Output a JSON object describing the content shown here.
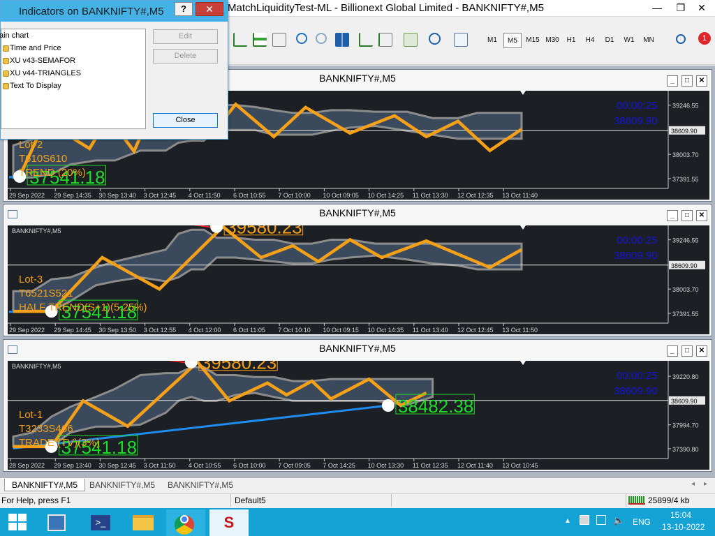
{
  "app": {
    "title": "MatchLiquidityTest-ML - Billionext Global Limited - BANKNIFTY#,M5"
  },
  "window_controls": {
    "minimize": "—",
    "restore": "❐",
    "close": "✕"
  },
  "toolbar": {
    "timeframes": [
      "M1",
      "M5",
      "M15",
      "M30",
      "H1",
      "H4",
      "D1",
      "W1",
      "MN"
    ],
    "active_timeframe": "M5",
    "notification_count": "1"
  },
  "dialog": {
    "title": "Indicators on BANKNIFTY#,M5",
    "help": "?",
    "close_x": "✕",
    "tree": [
      "ain chart",
      "Time and Price",
      "XU v43-SEMAFOR",
      "XU v44-TRIANGLES",
      "Text To Display"
    ],
    "buttons": {
      "edit": "Edit",
      "delete": "Delete",
      "close": "Close"
    }
  },
  "charts": [
    {
      "title": "BANKNIFTY#,M5",
      "symbol_label": "",
      "timer": "00:00:25",
      "current_price": "38609.90",
      "price_tag": "38609.90",
      "yticks": [
        {
          "v": 39246.55,
          "label": "39246.55"
        },
        {
          "v": 38003.7,
          "label": "38003.70"
        },
        {
          "v": 37391.55,
          "label": "37391.55"
        }
      ],
      "ymin": 37320,
      "ymax": 39540,
      "dates": [
        "29 Sep 2022",
        "29 Sep 14:35",
        "30 Sep 13:40",
        "3 Oct 12:45",
        "4 Oct 11:50",
        "6 Oct 10:55",
        "7 Oct 10:00",
        "10 Oct 09:05",
        "10 Oct 14:25",
        "11 Oct 13:30",
        "12 Oct 12:35",
        "13 Oct 11:40"
      ],
      "lot_lines": [
        "Lot-2",
        "T610S610",
        "TREND (20%)"
      ],
      "markers": [
        {
          "i": 1,
          "v": 37445,
          "label": "37541.18",
          "color": "#1fdc2a"
        }
      ],
      "zigzag": [
        [
          1,
          37445
        ],
        [
          5,
          38850
        ],
        [
          12,
          38150
        ],
        [
          15,
          38950
        ],
        [
          19,
          38080
        ],
        [
          23,
          39560
        ],
        [
          30,
          38850
        ],
        [
          32,
          38650
        ],
        [
          35,
          39270
        ],
        [
          41,
          38450
        ],
        [
          46,
          39190
        ],
        [
          53,
          38540
        ],
        [
          60,
          38980
        ],
        [
          65,
          38450
        ],
        [
          70,
          38840
        ],
        [
          75,
          38100
        ],
        [
          80,
          38640
        ]
      ],
      "envelope": {
        "top": [
          [
            0,
            38230
          ],
          [
            3,
            38380
          ],
          [
            6,
            38480
          ],
          [
            9,
            38680
          ],
          [
            13,
            38700
          ],
          [
            16,
            38880
          ],
          [
            20,
            38880
          ],
          [
            24,
            39000
          ],
          [
            26,
            39250
          ],
          [
            28,
            39450
          ],
          [
            30,
            39450
          ],
          [
            32,
            39250
          ],
          [
            35,
            39250
          ],
          [
            38,
            39200
          ],
          [
            41,
            39120
          ],
          [
            44,
            39050
          ],
          [
            47,
            39050
          ],
          [
            50,
            39120
          ],
          [
            53,
            39120
          ],
          [
            57,
            39080
          ],
          [
            62,
            39080
          ],
          [
            66,
            38920
          ],
          [
            70,
            38920
          ],
          [
            73,
            39050
          ],
          [
            80,
            39050
          ]
        ],
        "bottom": [
          [
            0,
            37420
          ],
          [
            3,
            37420
          ],
          [
            6,
            37500
          ],
          [
            9,
            37750
          ],
          [
            13,
            37850
          ],
          [
            16,
            37850
          ],
          [
            20,
            38100
          ],
          [
            24,
            38100
          ],
          [
            26,
            38300
          ],
          [
            28,
            38350
          ],
          [
            30,
            38350
          ],
          [
            32,
            38620
          ],
          [
            35,
            38620
          ],
          [
            38,
            38620
          ],
          [
            41,
            38500
          ],
          [
            44,
            38500
          ],
          [
            47,
            38500
          ],
          [
            50,
            38600
          ],
          [
            53,
            38680
          ],
          [
            57,
            38720
          ],
          [
            62,
            38600
          ],
          [
            66,
            38500
          ],
          [
            70,
            38400
          ],
          [
            73,
            38400
          ],
          [
            80,
            38400
          ]
        ]
      }
    },
    {
      "title": "BANKNIFTY#,M5",
      "symbol_label": "BANKNIFTY#,M5",
      "timer": "00:00:25",
      "current_price": "38609.90",
      "price_tag": "38609.90",
      "yticks": [
        {
          "v": 39246.55,
          "label": "39246.55"
        },
        {
          "v": 38003.7,
          "label": "38003.70"
        },
        {
          "v": 37391.55,
          "label": "37391.55"
        }
      ],
      "ymin": 37320,
      "ymax": 39540,
      "dates": [
        "29 Sep 2022",
        "29 Sep 14:45",
        "30 Sep 13:50",
        "3 Oct 12:55",
        "4 Oct 12:00",
        "6 Oct 11:05",
        "7 Oct 10:10",
        "10 Oct 09:15",
        "10 Oct 14:35",
        "11 Oct 13:40",
        "12 Oct 12:45",
        "13 Oct 11:50"
      ],
      "lot_lines": [
        "Lot-3",
        "T6521S521",
        "HALF TREND(S+1)(5.25%)"
      ],
      "markers": [
        {
          "i": 6,
          "v": 37441,
          "label": "37541.18",
          "color": "#1fdc2a"
        },
        {
          "i": 32,
          "v": 39580,
          "label": "39580.23",
          "color": "#f5a019"
        }
      ],
      "zigzag": [
        [
          0,
          37441
        ],
        [
          6,
          37441
        ],
        [
          14,
          38800
        ],
        [
          23,
          38003
        ],
        [
          33,
          39580
        ],
        [
          39,
          38800
        ],
        [
          44,
          39100
        ],
        [
          48,
          38700
        ],
        [
          53,
          39250
        ],
        [
          58,
          38800
        ],
        [
          65,
          39220
        ],
        [
          75,
          38550
        ],
        [
          80,
          39000
        ]
      ],
      "envelope": {
        "top": [
          [
            0,
            37950
          ],
          [
            3,
            37950
          ],
          [
            6,
            38250
          ],
          [
            9,
            38300
          ],
          [
            13,
            38550
          ],
          [
            16,
            38700
          ],
          [
            20,
            38850
          ],
          [
            24,
            39000
          ],
          [
            26,
            39400
          ],
          [
            28,
            39500
          ],
          [
            30,
            39500
          ],
          [
            32,
            39300
          ],
          [
            35,
            39300
          ],
          [
            38,
            39250
          ],
          [
            41,
            39250
          ],
          [
            44,
            39150
          ],
          [
            47,
            39150
          ],
          [
            50,
            39250
          ],
          [
            53,
            39250
          ],
          [
            57,
            39150
          ],
          [
            62,
            39150
          ],
          [
            66,
            39150
          ],
          [
            70,
            39150
          ],
          [
            73,
            39150
          ],
          [
            80,
            39150
          ]
        ],
        "bottom": [
          [
            0,
            37441
          ],
          [
            3,
            37441
          ],
          [
            6,
            37441
          ],
          [
            9,
            37700
          ],
          [
            13,
            38100
          ],
          [
            16,
            38200
          ],
          [
            20,
            38300
          ],
          [
            24,
            38200
          ],
          [
            26,
            38300
          ],
          [
            28,
            38500
          ],
          [
            30,
            38500
          ],
          [
            32,
            38800
          ],
          [
            35,
            38800
          ],
          [
            38,
            38750
          ],
          [
            41,
            38700
          ],
          [
            44,
            38650
          ],
          [
            47,
            38650
          ],
          [
            50,
            38750
          ],
          [
            53,
            38800
          ],
          [
            57,
            38850
          ],
          [
            62,
            38750
          ],
          [
            66,
            38650
          ],
          [
            70,
            38600
          ],
          [
            73,
            38500
          ],
          [
            80,
            38500
          ]
        ]
      }
    },
    {
      "title": "BANKNIFTY#,M5",
      "symbol_label": "BANKNIFTY#,M5",
      "timer": "00:00:25",
      "current_price": "38609.90",
      "price_tag": "38609.90",
      "yticks": [
        {
          "v": 39220.8,
          "label": "39220.80"
        },
        {
          "v": 37994.7,
          "label": "37994.70"
        },
        {
          "v": 37390.8,
          "label": "37390.80"
        }
      ],
      "ymin": 37320,
      "ymax": 39540,
      "dates": [
        "28 Sep 2022",
        "29 Sep 13:40",
        "30 Sep 12:45",
        "3 Oct 11:50",
        "4 Oct 10:55",
        "6 Oct 10:00",
        "7 Oct 09:05",
        "7 Oct 14:25",
        "10 Oct 13:30",
        "11 Oct 12:35",
        "12 Oct 11:40",
        "13 Oct 10:45"
      ],
      "lot_lines": [
        "Lot-1",
        "T3233S466",
        "TRADE (TV)(3%)"
      ],
      "markers": [
        {
          "i": 6,
          "v": 37445,
          "label": "37541.18",
          "color": "#1fdc2a"
        },
        {
          "i": 28,
          "v": 39580,
          "label": "39580.23",
          "color": "#f5a019"
        },
        {
          "i": 59,
          "v": 38482,
          "label": "38482.38",
          "color": "#1fdc2a"
        }
      ],
      "trendline": [
        [
          0,
          37400
        ],
        [
          59,
          38482
        ]
      ],
      "zigzag": [
        [
          0,
          37445
        ],
        [
          6,
          37445
        ],
        [
          11,
          38600
        ],
        [
          18,
          37960
        ],
        [
          29,
          39580
        ],
        [
          34,
          38600
        ],
        [
          40,
          39050
        ],
        [
          43,
          38750
        ],
        [
          47,
          39100
        ],
        [
          50,
          38650
        ],
        [
          56,
          39150
        ],
        [
          61,
          38482
        ],
        [
          65,
          38800
        ]
      ],
      "envelope": {
        "top": [
          [
            0,
            37700
          ],
          [
            3,
            37800
          ],
          [
            6,
            38200
          ],
          [
            9,
            38450
          ],
          [
            13,
            38700
          ],
          [
            16,
            38900
          ],
          [
            20,
            39250
          ],
          [
            24,
            39300
          ],
          [
            26,
            39300
          ],
          [
            28,
            39450
          ],
          [
            30,
            39450
          ],
          [
            32,
            39250
          ],
          [
            35,
            39250
          ],
          [
            38,
            39200
          ],
          [
            41,
            39200
          ],
          [
            44,
            39100
          ],
          [
            47,
            39100
          ],
          [
            50,
            39150
          ],
          [
            53,
            39150
          ],
          [
            57,
            39150
          ],
          [
            62,
            39150
          ],
          [
            66,
            39150
          ]
        ],
        "bottom": [
          [
            0,
            37445
          ],
          [
            3,
            37445
          ],
          [
            6,
            37445
          ],
          [
            9,
            37800
          ],
          [
            13,
            37950
          ],
          [
            16,
            37950
          ],
          [
            20,
            38000
          ],
          [
            24,
            38300
          ],
          [
            26,
            38600
          ],
          [
            28,
            38700
          ],
          [
            30,
            38600
          ],
          [
            32,
            38600
          ],
          [
            35,
            38750
          ],
          [
            38,
            38800
          ],
          [
            41,
            38700
          ],
          [
            44,
            38600
          ],
          [
            47,
            38600
          ],
          [
            50,
            38600
          ],
          [
            53,
            38600
          ],
          [
            57,
            38600
          ],
          [
            62,
            38500
          ],
          [
            66,
            38700
          ]
        ]
      }
    }
  ],
  "tabs": [
    "BANKNIFTY#,M5",
    "BANKNIFTY#,M5",
    "BANKNIFTY#,M5"
  ],
  "status": {
    "help": "For Help, press F1",
    "profile": "Default5",
    "traffic": "25899/4 kb"
  },
  "taskbar": {
    "lang": "ENG",
    "time": "15:04",
    "date": "13-10-2022"
  },
  "colors": {
    "envelope_fill": "#3a4a5c",
    "envelope_edge": "#8c8c8c",
    "zigzag": "#f5a019",
    "trendline": "#1e8cf0",
    "timer": "#1414d8",
    "background": "#1c1f24"
  }
}
